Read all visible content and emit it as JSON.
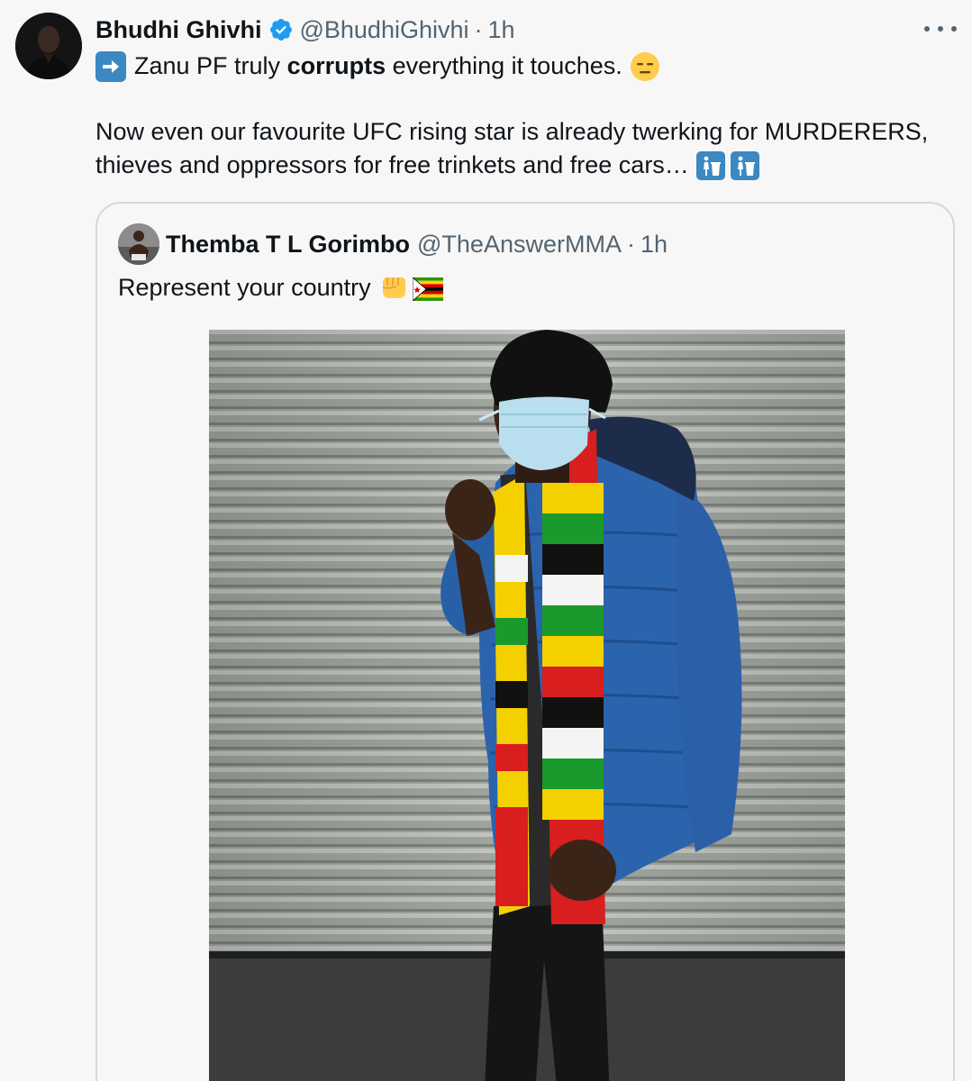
{
  "tweet": {
    "author_name": "Bhudhi Ghivhi",
    "author_handle": "@BhudhiGhivhi",
    "separator": "·",
    "time": "1h",
    "line1_before": "Zanu PF truly ",
    "line1_bold": "corrupts",
    "line1_after": " everything it touches.",
    "line2": "Now even our favourite UFC rising star is already twerking for MURDERERS,",
    "line3": "thieves and oppressors for free trinkets and free cars…",
    "icons": [
      "arrow-right-icon",
      "expressionless-face-icon",
      "put-litter-in-bin-icon",
      "put-litter-in-bin-icon",
      "verified-badge-icon",
      "more-icon"
    ]
  },
  "quoted_tweet": {
    "author_name": "Themba T L Gorimbo",
    "author_handle": "@TheAnswerMMA",
    "separator": "·",
    "time": "1h",
    "text": "Represent your country",
    "icons": [
      "oncoming-fist-icon",
      "zimbabwe-flag-icon"
    ]
  },
  "colors": {
    "text": "#0f1419",
    "secondary": "#536471",
    "border": "#cfd9de",
    "verified": "#1d9bf0",
    "background": "#f7f7f7"
  }
}
